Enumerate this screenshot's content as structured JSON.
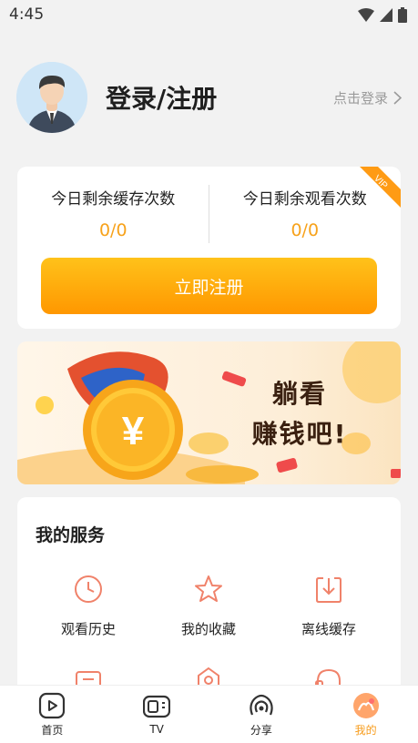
{
  "status_bar": {
    "time": "4:45"
  },
  "profile": {
    "title": "登录/注册",
    "login_link": "点击登录"
  },
  "quota": {
    "cache_label": "今日剩余缓存次数",
    "cache_value": "0/0",
    "watch_label": "今日剩余观看次数",
    "watch_value": "0/0",
    "vip_badge": "VIP",
    "register_button": "立即注册"
  },
  "banner": {
    "line1": "躺看",
    "line2": "赚钱吧!",
    "coin_symbol": "¥"
  },
  "services": {
    "title": "我的服务",
    "items": [
      {
        "label": "观看历史",
        "icon": "clock-icon"
      },
      {
        "label": "我的收藏",
        "icon": "star-icon"
      },
      {
        "label": "离线缓存",
        "icon": "download-icon"
      }
    ]
  },
  "tabs": [
    {
      "label": "首页",
      "icon": "play-icon"
    },
    {
      "label": "TV",
      "icon": "tv-icon"
    },
    {
      "label": "分享",
      "icon": "share-icon"
    },
    {
      "label": "我的",
      "icon": "user-icon",
      "active": true
    }
  ],
  "colors": {
    "accent": "#f79b1a",
    "button_top": "#ffc21a",
    "button_bottom": "#ff9700",
    "service_icon": "#f0826a"
  }
}
